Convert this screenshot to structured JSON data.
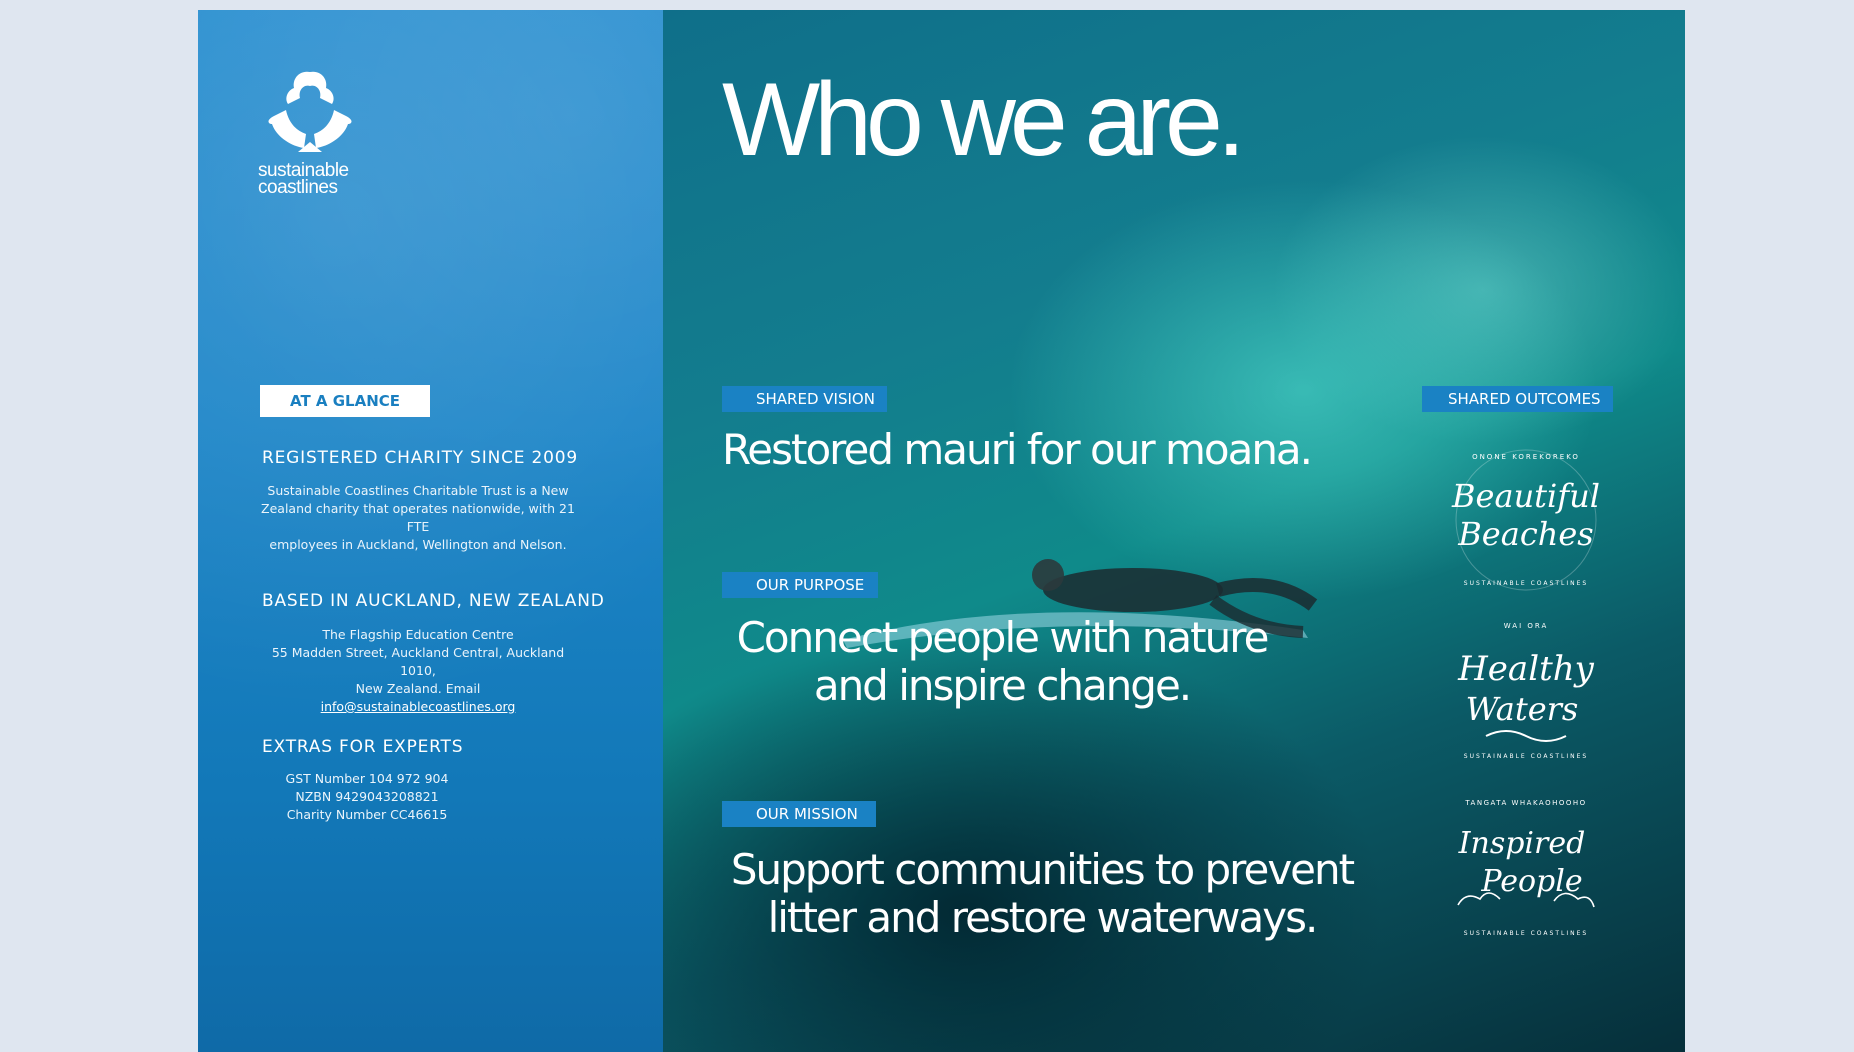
{
  "brand": {
    "logo_text_1": "sustainable",
    "logo_text_2": "coastlines"
  },
  "title": "Who we are.",
  "sidebar": {
    "at_a_glance": "AT A GLANCE",
    "charity_heading": "REGISTERED CHARITY SINCE 2009",
    "charity_text_1": "Sustainable Coastlines Charitable Trust is a New",
    "charity_text_2": "Zealand charity that operates nationwide, with 21 FTE",
    "charity_text_3": "employees in Auckland, Wellington and Nelson.",
    "based_heading": "BASED IN AUCKLAND, NEW ZEALAND",
    "address_1": "The Flagship Education Centre",
    "address_2": "55 Madden Street, Auckland Central, Auckland 1010,",
    "address_3": "New Zealand. Email",
    "email": "info@sustainablecoastlines.org",
    "extras_heading": "EXTRAS FOR EXPERTS",
    "gst": "GST Number 104 972 904",
    "nzbn": "NZBN 9429043208821",
    "charity_number": "Charity Number CC46615"
  },
  "vision": {
    "label": "SHARED VISION",
    "text": "Restored mauri for our moana."
  },
  "purpose": {
    "label": "OUR PURPOSE",
    "line1": "Connect people with nature",
    "line2": "and inspire change."
  },
  "mission": {
    "label": "OUR MISSION",
    "line1": "Support communities to prevent",
    "line2": "litter and restore waterways."
  },
  "outcomes": {
    "label": "SHARED OUTCOMES",
    "badges": [
      {
        "top": "ONONE KOREKOREKO",
        "script1": "Beautiful",
        "script2": "Beaches",
        "bottom": "SUSTAINABLE COASTLINES"
      },
      {
        "top": "WAI ORA",
        "script1": "Healthy",
        "script2": "Waters",
        "bottom": "SUSTAINABLE COASTLINES"
      },
      {
        "top": "TANGATA WHAKAOHOOHO",
        "script1": "Inspired",
        "script2": "People",
        "bottom": "SUSTAINABLE COASTLINES"
      }
    ]
  },
  "colors": {
    "blue": "#1a82c4",
    "white": "#ffffff",
    "teal": "#0f8a8a"
  }
}
